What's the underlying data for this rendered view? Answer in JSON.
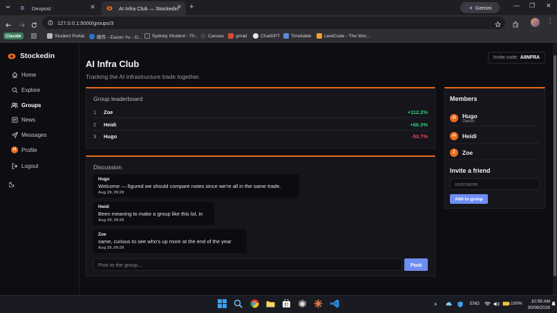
{
  "browser": {
    "tabs": [
      {
        "title": "Devpost",
        "favicon": "D"
      },
      {
        "title": "AI Infra Club — Stockedin",
        "favicon": "stockedin-logo"
      }
    ],
    "new_tab": "+",
    "gemini_label": "Gemini",
    "url": "127.0.0.1:5000/groups/3",
    "bookmarks": [
      {
        "label": "Claude",
        "color": "#3b7d5f"
      },
      {
        "label": "Student Portal",
        "color": "#b7b7b7"
      },
      {
        "label": "邮件 - Eason Yu - O...",
        "color": "#2f6fd6"
      },
      {
        "label": "Sydney Student - Th...",
        "color": "#333333"
      },
      {
        "label": "Canvas",
        "color": "#444444"
      },
      {
        "label": "gmail",
        "color": "#d94a3a"
      },
      {
        "label": "ChatGPT",
        "color": "#e6e6e6"
      },
      {
        "label": "Timetable",
        "color": "#5a8ad6"
      },
      {
        "label": "LeetCode - The Wor...",
        "color": "#f0a030"
      }
    ]
  },
  "sidebar": {
    "brand": "Stockedin",
    "items": [
      {
        "label": "Home",
        "icon": "home-icon"
      },
      {
        "label": "Explore",
        "icon": "search-icon"
      },
      {
        "label": "Groups",
        "icon": "users-icon",
        "active": true
      },
      {
        "label": "News",
        "icon": "newspaper-icon"
      },
      {
        "label": "Messages",
        "icon": "send-icon"
      },
      {
        "label": "Profile",
        "icon": "avatar",
        "initial": "H"
      },
      {
        "label": "Logout",
        "icon": "logout-icon"
      }
    ],
    "theme_toggle": "moon-icon"
  },
  "group": {
    "title": "AI Infra Club",
    "subtitle": "Tracking the AI infrastructure trade together.",
    "invite_label": "Invite code:",
    "invite_code": "AIINFRA"
  },
  "leaderboard": {
    "title": "Group leaderboard",
    "rows": [
      {
        "rank": "1",
        "name": "Zoe",
        "change": "+112.2%",
        "positive": true
      },
      {
        "rank": "2",
        "name": "Heidi",
        "change": "+66.3%",
        "positive": true
      },
      {
        "rank": "3",
        "name": "Hugo",
        "change": "-53.7%",
        "positive": false
      }
    ]
  },
  "discussion": {
    "title": "Discussion",
    "messages": [
      {
        "author": "Hugo",
        "text": "Welcome — figured we should compare notes since we're all in the same trade.",
        "time": "Aug 29, 09:29"
      },
      {
        "author": "Heidi",
        "text": "Been meaning to make a group like this lol, in",
        "time": "Aug 29, 09:29"
      },
      {
        "author": "Zoe",
        "text": "same, curious to see who's up more at the end of the year",
        "time": "Aug 29, 09:29"
      }
    ],
    "post_placeholder": "Post to the group...",
    "post_button": "Post"
  },
  "members": {
    "title": "Members",
    "list": [
      {
        "initial": "H",
        "name": "Hugo",
        "role": "Owner"
      },
      {
        "initial": "H",
        "name": "Heidi",
        "role": ""
      },
      {
        "initial": "Z",
        "name": "Zoe",
        "role": ""
      }
    ],
    "invite_title": "Invite a friend",
    "username_placeholder": "username",
    "add_button": "Add to group"
  },
  "taskbar": {
    "lang": "ENG",
    "battery": "100%",
    "time": "10:59 AM",
    "date": "30/08/2026"
  },
  "colors": {
    "accent": "#ea6a1e",
    "button": "#6e8df2",
    "positive": "#2fd07a",
    "negative": "#ef4a5a"
  }
}
